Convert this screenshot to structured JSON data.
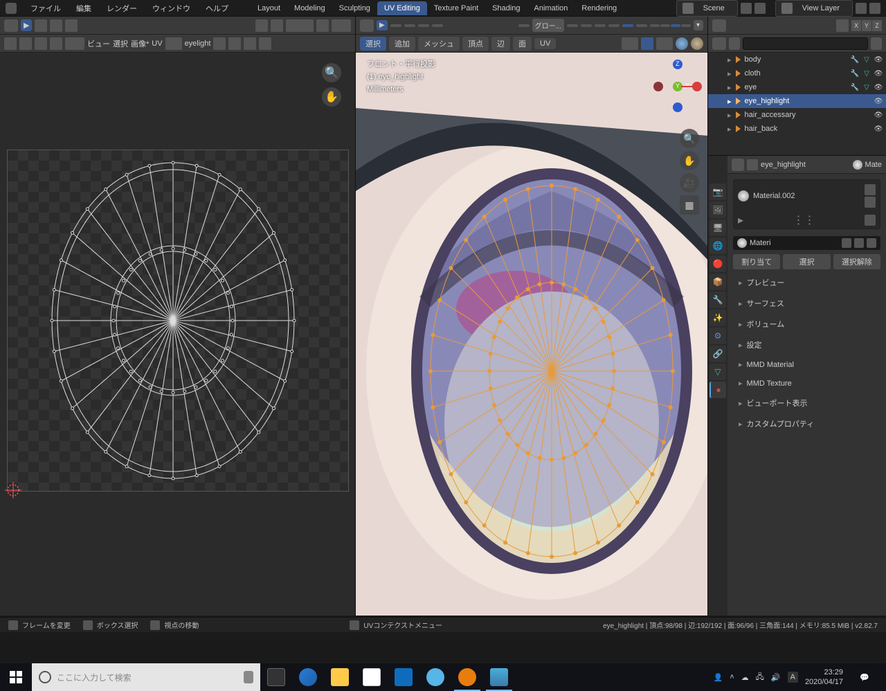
{
  "top_menu": {
    "items": [
      "ファイル",
      "編集",
      "レンダー",
      "ウィンドウ",
      "ヘルプ"
    ],
    "workspaces": [
      "Layout",
      "Modeling",
      "Sculpting",
      "UV Editing",
      "Texture Paint",
      "Shading",
      "Animation",
      "Rendering"
    ],
    "active_workspace": "UV Editing",
    "scene_label": "Scene",
    "view_layer_label": "View Layer"
  },
  "uv_editor": {
    "header1": {
      "select_label": "▼"
    },
    "header2": {
      "items": [
        "ビュー",
        "選択",
        "画像*",
        "UV"
      ],
      "image_name": "eyelight"
    }
  },
  "viewport_3d": {
    "header2": {
      "items": [
        "選択",
        "追加",
        "メッシュ",
        "頂点",
        "辺",
        "面",
        "UV"
      ],
      "active": "選択"
    },
    "shading_dropdown": "グロー...",
    "overlay": {
      "line1": "フロント・平行投影",
      "line2": "(1) eye_highlight",
      "line3": "Millimeters"
    },
    "axes": {
      "x": "X",
      "y": "Y",
      "z": "Z"
    }
  },
  "outliner": {
    "search_placeholder": "",
    "items": [
      {
        "name": "body",
        "selected": false
      },
      {
        "name": "cloth",
        "selected": false
      },
      {
        "name": "eye",
        "selected": false
      },
      {
        "name": "eye_highlight",
        "selected": true
      },
      {
        "name": "hair_accessary",
        "selected": false
      },
      {
        "name": "hair_back",
        "selected": false
      }
    ]
  },
  "properties": {
    "object_name": "eye_highlight",
    "material_suffix": "Mate",
    "material_slot": "Material.002",
    "material_name_prefix": "Materi",
    "assign": [
      "割り当て",
      "選択",
      "選択解除"
    ],
    "panels": [
      "プレビュー",
      "サーフェス",
      "ボリューム",
      "設定",
      "MMD Material",
      "MMD Texture",
      "ビューポート表示",
      "カスタムプロパティ"
    ]
  },
  "status_bar": {
    "left": [
      {
        "icon": true,
        "text": "フレームを変更"
      },
      {
        "icon": true,
        "text": "ボックス選択"
      },
      {
        "icon": true,
        "text": "視点の移動"
      }
    ],
    "center": {
      "icon": true,
      "text": "UVコンテクストメニュー"
    },
    "right": "eye_highlight | 頂点:98/98 | 辺:192/192 | 面:96/96 | 三角面:144 | メモリ:85.5 MiB | v2.82.7"
  },
  "taskbar": {
    "search_placeholder": "ここに入力して検索",
    "time": "23:29",
    "date": "2020/04/17",
    "ime": "A"
  }
}
